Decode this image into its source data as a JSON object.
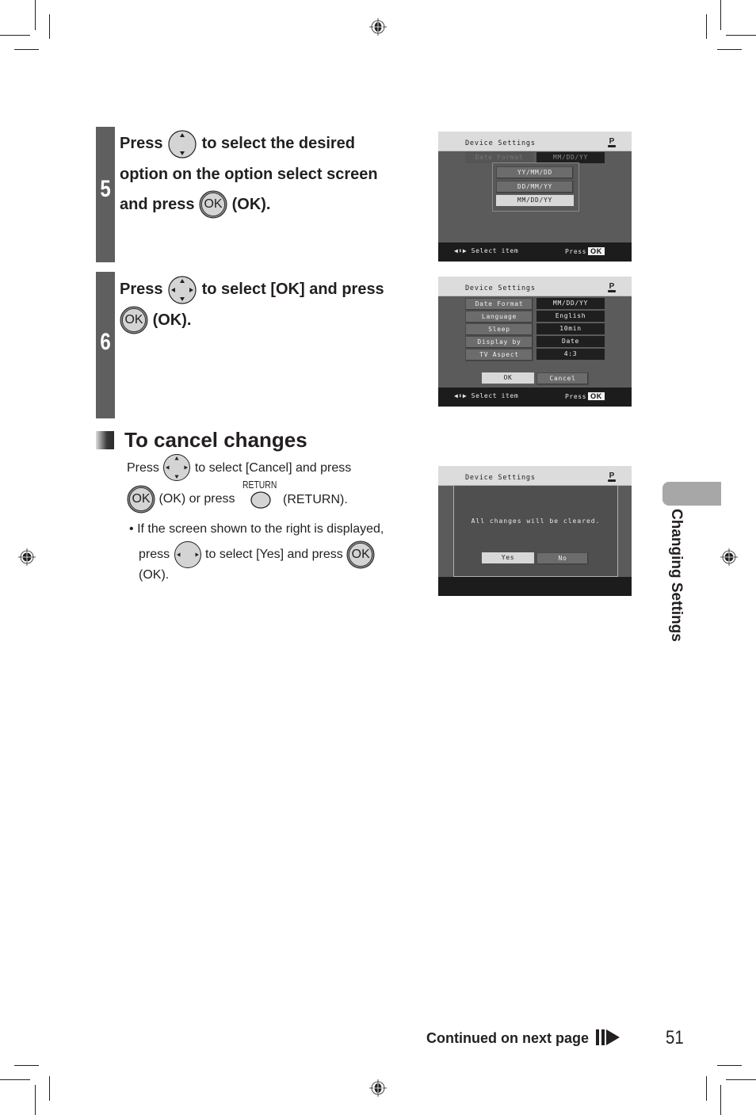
{
  "step5": {
    "number": "5",
    "line1_before": "Press",
    "line1_after": "to select the desired",
    "line2": "option on the option select screen",
    "line3_before": "and press",
    "line3_after": "(OK).",
    "dpad_icon": "dpad-up-down-icon",
    "ok_icon": "ok-button-icon",
    "ok_icon_label": "OK"
  },
  "step6": {
    "number": "6",
    "line1_before": "Press",
    "line1_after": "to select [OK] and press",
    "line2_after": "(OK).",
    "dpad_icon": "dpad-four-way-icon",
    "ok_icon_label": "OK"
  },
  "screen1": {
    "title": "Device Settings",
    "icon": "printer-p-icon",
    "icon_label": "P",
    "row_label": "Date Format",
    "row_value": "MM/DD/YY",
    "options": [
      "YY/MM/DD",
      "DD/MM/YY",
      "MM/DD/YY"
    ],
    "selected_option": "MM/DD/YY",
    "footer_select": "Select item",
    "footer_press": "Press",
    "footer_ok": "OK"
  },
  "screen2": {
    "title": "Device Settings",
    "icon_label": "P",
    "rows": [
      {
        "label": "Date Format",
        "value": "MM/DD/YY"
      },
      {
        "label": "Language",
        "value": "English"
      },
      {
        "label": "Sleep",
        "value": "10min"
      },
      {
        "label": "Display by",
        "value": "Date"
      },
      {
        "label": "TV Aspect",
        "value": "4:3"
      }
    ],
    "ok_button": "OK",
    "cancel_button": "Cancel",
    "selected_button": "OK",
    "footer_select": "Select item",
    "footer_press": "Press",
    "footer_ok": "OK"
  },
  "screen3": {
    "title": "Device Settings",
    "icon_label": "P",
    "message": "All changes will be cleared.",
    "yes_button": "Yes",
    "no_button": "No",
    "selected_button": "Yes"
  },
  "cancel_section": {
    "title": "To cancel changes",
    "line1_before": "Press",
    "line1_after": "to select [Cancel] and press",
    "line2_ok": "OK",
    "line2_mid": "(OK) or press",
    "return_label": "RETURN",
    "line2_after": "(RETURN).",
    "bullet": "•",
    "bullet_line1": "If the screen shown to the right is displayed,",
    "bullet_line2_before": "press",
    "bullet_line2_mid": "to select [Yes] and press",
    "bullet_line3": "(OK)."
  },
  "side_tab": {
    "label": "Changing Settings"
  },
  "footer": {
    "continued": "Continued on next page",
    "page_number": "51"
  },
  "colors": {
    "step_bar": "#5f5f5f",
    "side_tab": "#a7a7a7",
    "text": "#231f20"
  }
}
